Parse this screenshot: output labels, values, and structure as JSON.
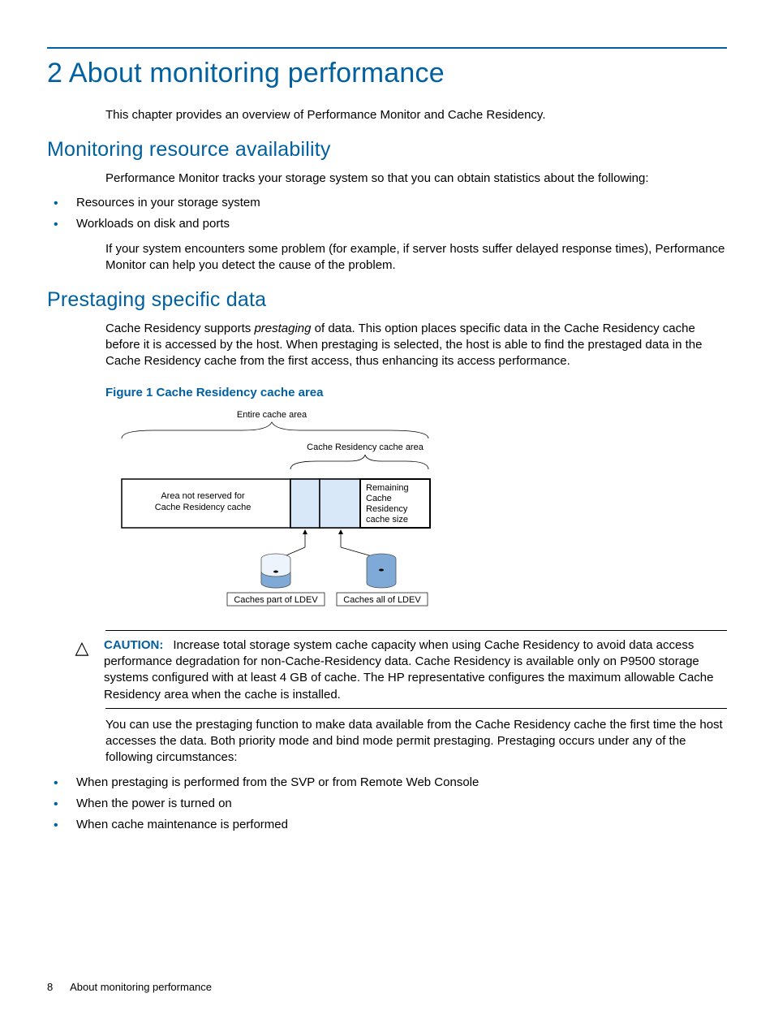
{
  "footer": {
    "page_number": "8",
    "running_head": "About monitoring performance"
  },
  "chapter": {
    "title": "2 About monitoring performance"
  },
  "intro_para": "This chapter provides an overview of Performance Monitor and Cache Residency.",
  "section1": {
    "heading": "Monitoring resource availability",
    "lead": "Performance Monitor tracks your storage system so that you can obtain statistics about the following:",
    "bullets": [
      "Resources in your storage system",
      "Workloads on disk and ports"
    ],
    "tail": "If your system encounters some problem (for example, if server hosts suffer delayed response times), Performance Monitor can help you detect the cause of the problem."
  },
  "section2": {
    "heading": "Prestaging specific data",
    "para_pre": "Cache Residency supports ",
    "para_em": "prestaging",
    "para_post": " of data. This option places specific data in the Cache Residency cache before it is accessed by the host. When prestaging is selected, the host is able to find the prestaged data in the Cache Residency cache from the first access, thus enhancing its access performance.",
    "figure": {
      "caption": "Figure 1 Cache Residency cache area",
      "labels": {
        "entire": "Entire cache area",
        "crm_area": "Cache Residency cache area",
        "not_reserved": "Area not reserved for\nCache Residency cache",
        "remaining": "Remaining\nCache\nResidency\ncache size",
        "part": "Caches part of LDEV",
        "all": "Caches all of LDEV"
      }
    },
    "caution_label": "CAUTION:",
    "caution_text": "Increase total storage system cache capacity when using Cache Residency to avoid data access performance degradation for non-Cache-Residency data. Cache Residency is available only on P9500 storage systems configured with at least 4 GB of cache. The HP representative configures the maximum allowable Cache Residency area when the cache is installed.",
    "after_caution": "You can use the prestaging function to make data available from the Cache Residency cache the first time the host accesses the data. Both priority mode and bind mode permit prestaging. Prestaging occurs under any of the following circumstances:",
    "bullets2": [
      "When prestaging is performed from the SVP or from Remote Web Console",
      "When the power is turned on",
      "When cache maintenance is performed"
    ]
  }
}
